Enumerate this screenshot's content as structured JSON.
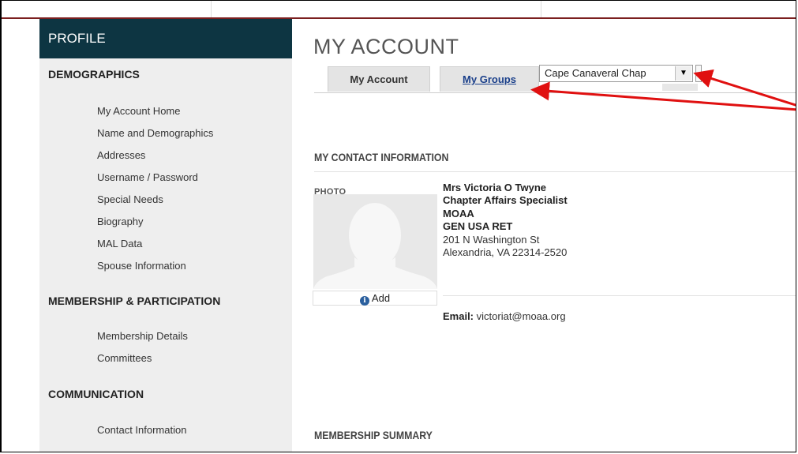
{
  "sidebar": {
    "title": "PROFILE",
    "sections": [
      {
        "heading": "DEMOGRAPHICS",
        "items": [
          "My Account Home",
          "Name and Demographics",
          "Addresses",
          "Username / Password",
          "Special Needs",
          "Biography",
          "MAL Data",
          "Spouse Information"
        ]
      },
      {
        "heading": "MEMBERSHIP & PARTICIPATION",
        "items": [
          "Membership Details",
          "Committees"
        ]
      },
      {
        "heading": "COMMUNICATION",
        "items": [
          "Contact Information"
        ]
      }
    ]
  },
  "main": {
    "title": "MY ACCOUNT",
    "tabs": [
      "My Account",
      "My Groups"
    ],
    "group_select": {
      "selected": "Cape Canaveral Chap"
    },
    "contact_section": {
      "heading": "MY CONTACT INFORMATION",
      "photo_label": "PHOTO",
      "add_label": "Add",
      "lines": [
        {
          "text": "Mrs Victoria O Twyne",
          "bold": true
        },
        {
          "text": "Chapter Affairs Specialist",
          "bold": true
        },
        {
          "text": "MOAA",
          "bold": true
        },
        {
          "text": "GEN USA RET",
          "bold": true
        },
        {
          "text": "201 N Washington St",
          "bold": false
        },
        {
          "text": "Alexandria, VA  22314-2520",
          "bold": false
        }
      ],
      "email_label": "Email:",
      "email": "victoriat@moaa.org"
    },
    "membership_section": {
      "heading": "MEMBERSHIP SUMMARY"
    }
  },
  "colors": {
    "profile_header": "#0d3542",
    "sidebar_bg": "#eeeeee",
    "top_border": "#7b1f1f",
    "link": "#1a3f8a",
    "annotation_arrow": "#e01010"
  },
  "icons": {
    "info": "info-circle-icon",
    "dropdown": "caret-down-icon",
    "avatar": "avatar-silhouette-icon"
  }
}
